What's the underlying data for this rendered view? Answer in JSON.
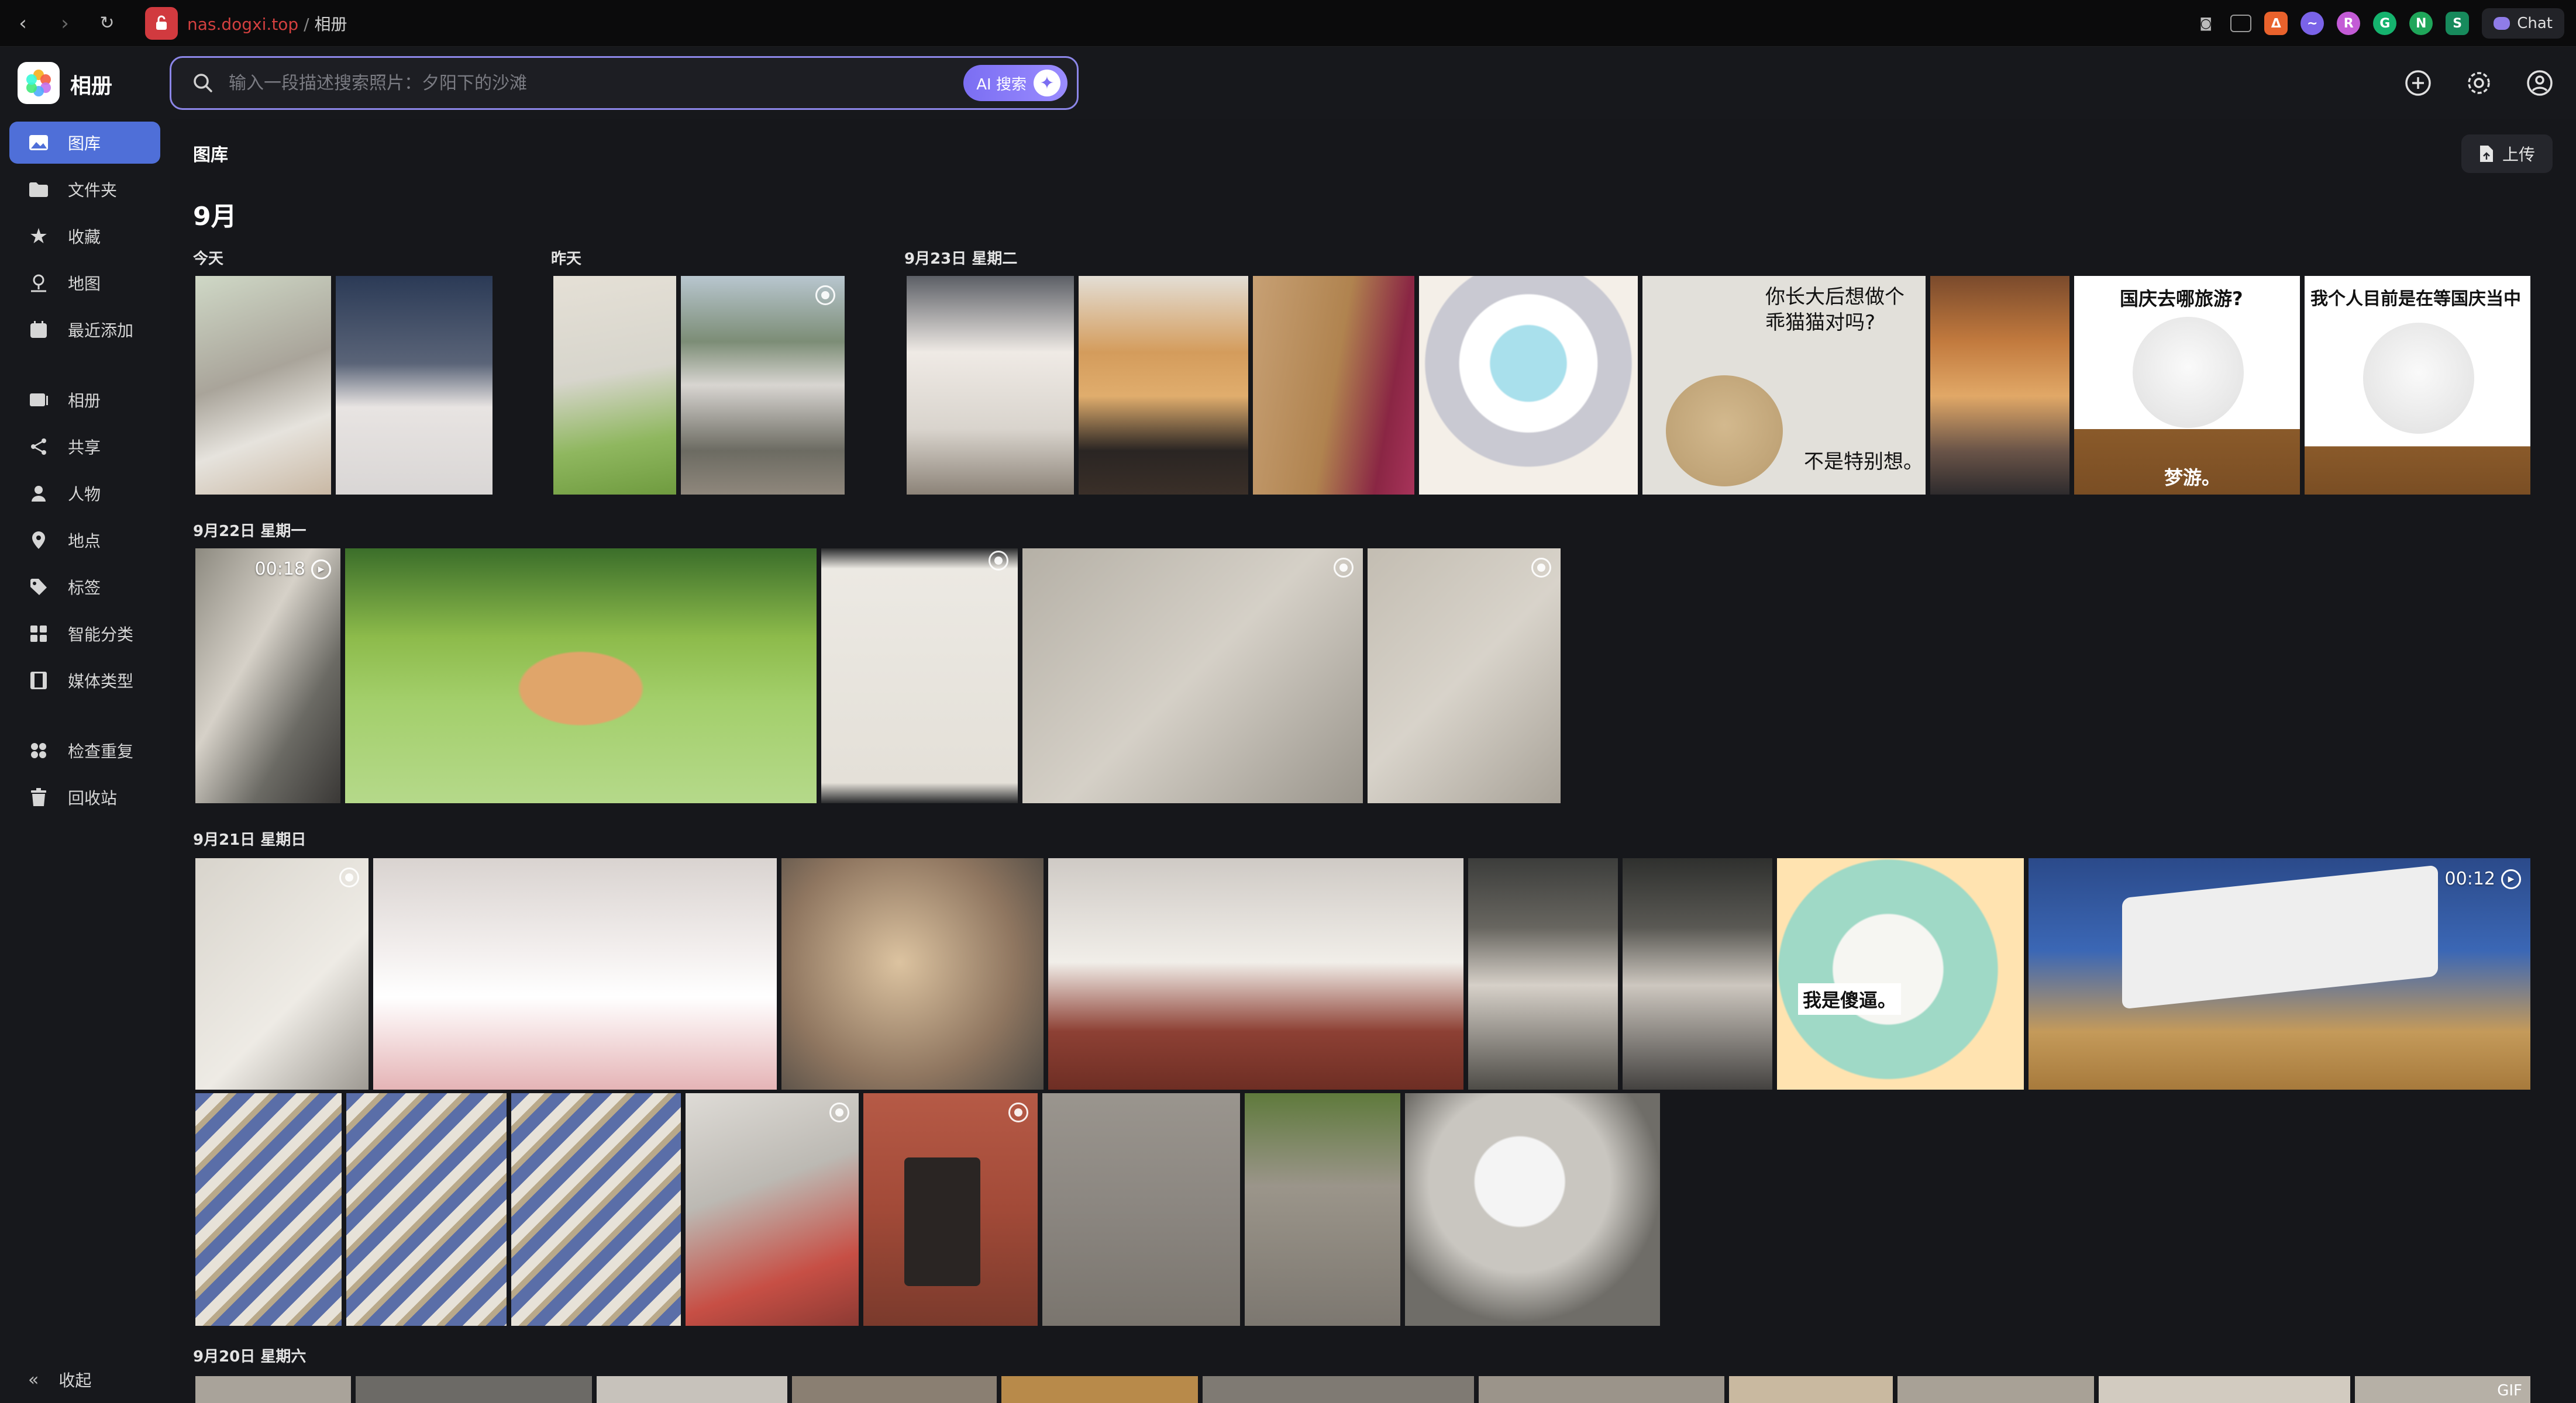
{
  "browser": {
    "url_host": "nas.dogxi.top",
    "url_path": "相册",
    "chat_label": "Chat"
  },
  "app": {
    "title": "相册"
  },
  "search": {
    "placeholder": "输入一段描述搜索照片：夕阳下的沙滩",
    "ai_label": "AI 搜索"
  },
  "sidebar": {
    "items": [
      {
        "label": "图库",
        "icon": "photo-icon"
      },
      {
        "label": "文件夹",
        "icon": "folder-icon"
      },
      {
        "label": "收藏",
        "icon": "star-icon"
      },
      {
        "label": "地图",
        "icon": "map-icon"
      },
      {
        "label": "最近添加",
        "icon": "calendar-icon"
      },
      {
        "label": "相册",
        "icon": "albums-icon"
      },
      {
        "label": "共享",
        "icon": "share-icon"
      },
      {
        "label": "人物",
        "icon": "person-icon"
      },
      {
        "label": "地点",
        "icon": "pin-icon"
      },
      {
        "label": "标签",
        "icon": "tag-icon"
      },
      {
        "label": "智能分类",
        "icon": "grid-icon"
      },
      {
        "label": "媒体类型",
        "icon": "film-icon"
      },
      {
        "label": "检查重复",
        "icon": "duplicate-icon"
      },
      {
        "label": "回收站",
        "icon": "trash-icon"
      }
    ],
    "collapse_label": "收起"
  },
  "main": {
    "page_title": "图库",
    "upload_label": "上传",
    "month": "9月",
    "groups": {
      "today": "今天",
      "yesterday": "昨天",
      "sep23": "9月23日 星期二",
      "sep22": "9月22日 星期一",
      "sep21": "9月21日 星期日",
      "sep20": "9月20日 星期六"
    },
    "durations": {
      "v1": "00:18",
      "v2": "00:12"
    },
    "captions": {
      "meme_question": "你长大后想做个乖猫猫对吗?",
      "meme_answer": "不是特别想。",
      "guoqing_q": "国庆去哪旅游?",
      "guoqing_a": "梦游。",
      "guoqing_wait": "我个人目前是在等国庆当中",
      "sheep": "我是傻逼。",
      "gif": "GIF"
    }
  },
  "colors": {
    "accent": "#4f6fd8",
    "search_border": "#8c86e8",
    "site_badge": "#d13a3f"
  }
}
